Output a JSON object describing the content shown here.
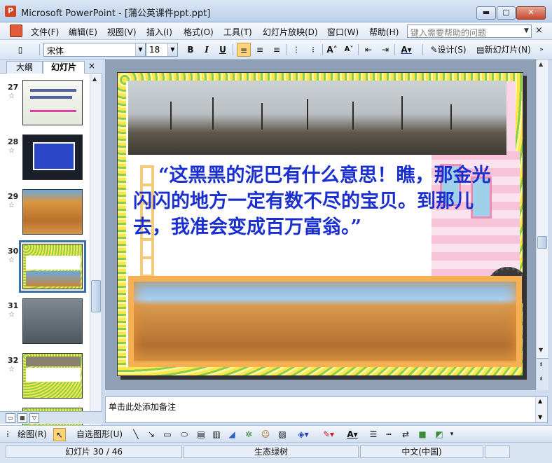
{
  "window": {
    "title": "Microsoft PowerPoint - [蒲公英课件ppt.ppt]",
    "min_glyph": "▬",
    "max_glyph": "▢",
    "close_glyph": "✕"
  },
  "menu": {
    "items": [
      "文件(F)",
      "编辑(E)",
      "视图(V)",
      "插入(I)",
      "格式(O)",
      "工具(T)",
      "幻灯片放映(D)",
      "窗口(W)",
      "帮助(H)"
    ],
    "help_placeholder": "键入需要帮助的问题",
    "close_glyph": "×"
  },
  "toolbar": {
    "font_name": "宋体",
    "font_size": "18",
    "bold": "B",
    "italic": "I",
    "underline": "U",
    "design_label": "设计(S)",
    "new_slide_label": "新幻灯片(N)"
  },
  "left_pane": {
    "tab_outline": "大纲",
    "tab_slides": "幻灯片",
    "close_glyph": "×",
    "slides": [
      {
        "number": "27",
        "theme": "light"
      },
      {
        "number": "28",
        "theme": "dark"
      },
      {
        "number": "29",
        "theme": "desert"
      },
      {
        "number": "30",
        "theme": "current",
        "selected": true
      },
      {
        "number": "31",
        "theme": "water"
      },
      {
        "number": "32",
        "theme": "frame"
      }
    ]
  },
  "slide": {
    "poem": "“这黑黑的泥巴有什么意思！瞧，那金光闪闪的地方一定有数不尽的宝贝。到那儿去，我准会变成百万富翁。”"
  },
  "notes": {
    "placeholder": "单击此处添加备注"
  },
  "drawbar": {
    "draw_label": "绘图(R)",
    "autoshapes_label": "自选图形(U)"
  },
  "status": {
    "slide_index": "幻灯片 30 / 46",
    "template": "生态绿树",
    "language": "中文(中国)"
  },
  "colors": {
    "poem_text": "#1a2fd0",
    "accent": "#ffd37c"
  }
}
